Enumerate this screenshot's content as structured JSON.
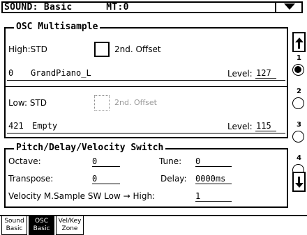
{
  "header": {
    "title": "SOUND: Basic      MT:0"
  },
  "osc_multisample": {
    "title": "OSC Multisample",
    "high": {
      "label": "High:STD",
      "offset_label": "2nd. Offset",
      "sample_number": "0",
      "sample_name": "GrandPiano_L",
      "level_label": "Level:",
      "level_value": "127"
    },
    "low": {
      "label": "Low: STD",
      "offset_label": "2nd. Offset",
      "sample_number": "421",
      "sample_name": "Empty",
      "level_label": "Level:",
      "level_value": "115"
    }
  },
  "pitch_switch": {
    "title": "Pitch/Delay/Velocity Switch",
    "octave_label": "Octave:",
    "octave_value": "0",
    "tune_label": "Tune:",
    "tune_value": "0",
    "transpose_label": "Transpose:",
    "transpose_value": "0",
    "delay_label": "Delay:",
    "delay_value": "0000ms",
    "velocity_label": "Velocity M.Sample SW Low → High:",
    "velocity_value": "1"
  },
  "pager": {
    "pages": [
      "1",
      "2",
      "3",
      "4"
    ],
    "selected": "1"
  },
  "tabs": [
    {
      "line1": "Sound",
      "line2": "Basic",
      "active": false
    },
    {
      "line1": "OSC",
      "line2": "Basic",
      "active": true
    },
    {
      "line1": "Vel/Key",
      "line2": "Zone",
      "active": false
    }
  ]
}
